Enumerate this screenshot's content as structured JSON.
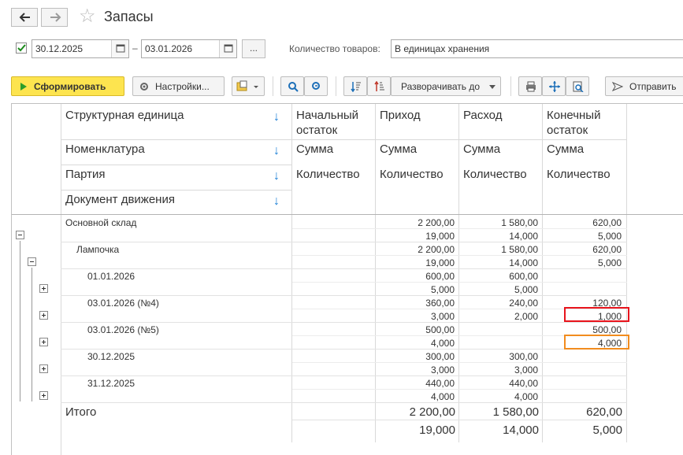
{
  "window": {
    "title": "Запасы",
    "back_icon": "arrow-left-icon",
    "forward_icon": "arrow-right-icon",
    "favorite_icon": "star-icon"
  },
  "filter": {
    "period_enabled": true,
    "date_from": "30.12.2025",
    "date_to": "03.01.2026",
    "separator": "–",
    "more_button": "...",
    "quantity_label": "Количество товаров:",
    "quantity_value": "В единицах хранения"
  },
  "toolbar": {
    "generate": "Сформировать",
    "settings": "Настройки...",
    "expand_to": "Разворачивать до",
    "send": "Отправить"
  },
  "report": {
    "headers": {
      "row1": "Структурная единица",
      "row2": "Номенклатура",
      "row3": "Партия",
      "row4": "Документ движения",
      "col_start": [
        "Начальный",
        "остаток"
      ],
      "col_in": "Приход",
      "col_out": "Расход",
      "col_end": [
        "Конечный",
        "остаток"
      ],
      "sum": "Сумма",
      "qty": "Количество"
    },
    "rows": [
      {
        "name": "Основной склад",
        "sum": [
          "",
          "2 200,00",
          "1 580,00",
          "620,00"
        ],
        "qty": [
          "",
          "19,000",
          "14,000",
          "5,000"
        ]
      },
      {
        "name": "Лампочка",
        "sum": [
          "",
          "2 200,00",
          "1 580,00",
          "620,00"
        ],
        "qty": [
          "",
          "19,000",
          "14,000",
          "5,000"
        ]
      },
      {
        "name": "01.01.2026",
        "sum": [
          "",
          "600,00",
          "600,00",
          ""
        ],
        "qty": [
          "",
          "5,000",
          "5,000",
          ""
        ]
      },
      {
        "name": "03.01.2026 (№4)",
        "sum": [
          "",
          "360,00",
          "240,00",
          "120,00"
        ],
        "qty": [
          "",
          "3,000",
          "2,000",
          "1,000"
        ]
      },
      {
        "name": "03.01.2026 (№5)",
        "sum": [
          "",
          "500,00",
          "",
          "500,00"
        ],
        "qty": [
          "",
          "4,000",
          "",
          "4,000"
        ]
      },
      {
        "name": "30.12.2025",
        "sum": [
          "",
          "300,00",
          "300,00",
          ""
        ],
        "qty": [
          "",
          "3,000",
          "3,000",
          ""
        ]
      },
      {
        "name": "31.12.2025",
        "sum": [
          "",
          "440,00",
          "440,00",
          ""
        ],
        "qty": [
          "",
          "4,000",
          "4,000",
          ""
        ]
      }
    ],
    "total": {
      "name": "Итого",
      "sum": [
        "",
        "2 200,00",
        "1 580,00",
        "620,00"
      ],
      "qty": [
        "",
        "19,000",
        "14,000",
        "5,000"
      ]
    },
    "highlight_colors": {
      "red": "#e8141c",
      "orange": "#f28c1e"
    }
  }
}
